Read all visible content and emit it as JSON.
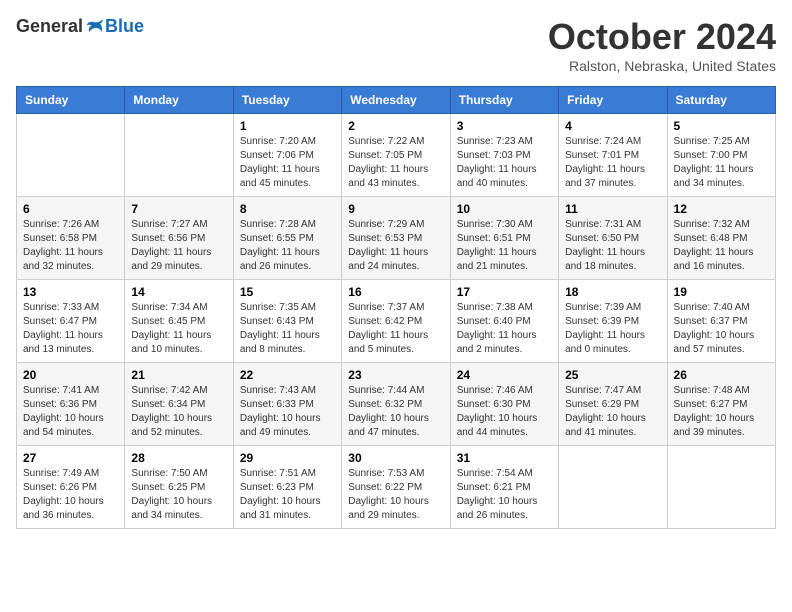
{
  "header": {
    "logo_general": "General",
    "logo_blue": "Blue",
    "title": "October 2024",
    "location": "Ralston, Nebraska, United States"
  },
  "calendar": {
    "days_of_week": [
      "Sunday",
      "Monday",
      "Tuesday",
      "Wednesday",
      "Thursday",
      "Friday",
      "Saturday"
    ],
    "weeks": [
      [
        {
          "day": "",
          "sunrise": "",
          "sunset": "",
          "daylight": ""
        },
        {
          "day": "",
          "sunrise": "",
          "sunset": "",
          "daylight": ""
        },
        {
          "day": "1",
          "sunrise": "Sunrise: 7:20 AM",
          "sunset": "Sunset: 7:06 PM",
          "daylight": "Daylight: 11 hours and 45 minutes."
        },
        {
          "day": "2",
          "sunrise": "Sunrise: 7:22 AM",
          "sunset": "Sunset: 7:05 PM",
          "daylight": "Daylight: 11 hours and 43 minutes."
        },
        {
          "day": "3",
          "sunrise": "Sunrise: 7:23 AM",
          "sunset": "Sunset: 7:03 PM",
          "daylight": "Daylight: 11 hours and 40 minutes."
        },
        {
          "day": "4",
          "sunrise": "Sunrise: 7:24 AM",
          "sunset": "Sunset: 7:01 PM",
          "daylight": "Daylight: 11 hours and 37 minutes."
        },
        {
          "day": "5",
          "sunrise": "Sunrise: 7:25 AM",
          "sunset": "Sunset: 7:00 PM",
          "daylight": "Daylight: 11 hours and 34 minutes."
        }
      ],
      [
        {
          "day": "6",
          "sunrise": "Sunrise: 7:26 AM",
          "sunset": "Sunset: 6:58 PM",
          "daylight": "Daylight: 11 hours and 32 minutes."
        },
        {
          "day": "7",
          "sunrise": "Sunrise: 7:27 AM",
          "sunset": "Sunset: 6:56 PM",
          "daylight": "Daylight: 11 hours and 29 minutes."
        },
        {
          "day": "8",
          "sunrise": "Sunrise: 7:28 AM",
          "sunset": "Sunset: 6:55 PM",
          "daylight": "Daylight: 11 hours and 26 minutes."
        },
        {
          "day": "9",
          "sunrise": "Sunrise: 7:29 AM",
          "sunset": "Sunset: 6:53 PM",
          "daylight": "Daylight: 11 hours and 24 minutes."
        },
        {
          "day": "10",
          "sunrise": "Sunrise: 7:30 AM",
          "sunset": "Sunset: 6:51 PM",
          "daylight": "Daylight: 11 hours and 21 minutes."
        },
        {
          "day": "11",
          "sunrise": "Sunrise: 7:31 AM",
          "sunset": "Sunset: 6:50 PM",
          "daylight": "Daylight: 11 hours and 18 minutes."
        },
        {
          "day": "12",
          "sunrise": "Sunrise: 7:32 AM",
          "sunset": "Sunset: 6:48 PM",
          "daylight": "Daylight: 11 hours and 16 minutes."
        }
      ],
      [
        {
          "day": "13",
          "sunrise": "Sunrise: 7:33 AM",
          "sunset": "Sunset: 6:47 PM",
          "daylight": "Daylight: 11 hours and 13 minutes."
        },
        {
          "day": "14",
          "sunrise": "Sunrise: 7:34 AM",
          "sunset": "Sunset: 6:45 PM",
          "daylight": "Daylight: 11 hours and 10 minutes."
        },
        {
          "day": "15",
          "sunrise": "Sunrise: 7:35 AM",
          "sunset": "Sunset: 6:43 PM",
          "daylight": "Daylight: 11 hours and 8 minutes."
        },
        {
          "day": "16",
          "sunrise": "Sunrise: 7:37 AM",
          "sunset": "Sunset: 6:42 PM",
          "daylight": "Daylight: 11 hours and 5 minutes."
        },
        {
          "day": "17",
          "sunrise": "Sunrise: 7:38 AM",
          "sunset": "Sunset: 6:40 PM",
          "daylight": "Daylight: 11 hours and 2 minutes."
        },
        {
          "day": "18",
          "sunrise": "Sunrise: 7:39 AM",
          "sunset": "Sunset: 6:39 PM",
          "daylight": "Daylight: 11 hours and 0 minutes."
        },
        {
          "day": "19",
          "sunrise": "Sunrise: 7:40 AM",
          "sunset": "Sunset: 6:37 PM",
          "daylight": "Daylight: 10 hours and 57 minutes."
        }
      ],
      [
        {
          "day": "20",
          "sunrise": "Sunrise: 7:41 AM",
          "sunset": "Sunset: 6:36 PM",
          "daylight": "Daylight: 10 hours and 54 minutes."
        },
        {
          "day": "21",
          "sunrise": "Sunrise: 7:42 AM",
          "sunset": "Sunset: 6:34 PM",
          "daylight": "Daylight: 10 hours and 52 minutes."
        },
        {
          "day": "22",
          "sunrise": "Sunrise: 7:43 AM",
          "sunset": "Sunset: 6:33 PM",
          "daylight": "Daylight: 10 hours and 49 minutes."
        },
        {
          "day": "23",
          "sunrise": "Sunrise: 7:44 AM",
          "sunset": "Sunset: 6:32 PM",
          "daylight": "Daylight: 10 hours and 47 minutes."
        },
        {
          "day": "24",
          "sunrise": "Sunrise: 7:46 AM",
          "sunset": "Sunset: 6:30 PM",
          "daylight": "Daylight: 10 hours and 44 minutes."
        },
        {
          "day": "25",
          "sunrise": "Sunrise: 7:47 AM",
          "sunset": "Sunset: 6:29 PM",
          "daylight": "Daylight: 10 hours and 41 minutes."
        },
        {
          "day": "26",
          "sunrise": "Sunrise: 7:48 AM",
          "sunset": "Sunset: 6:27 PM",
          "daylight": "Daylight: 10 hours and 39 minutes."
        }
      ],
      [
        {
          "day": "27",
          "sunrise": "Sunrise: 7:49 AM",
          "sunset": "Sunset: 6:26 PM",
          "daylight": "Daylight: 10 hours and 36 minutes."
        },
        {
          "day": "28",
          "sunrise": "Sunrise: 7:50 AM",
          "sunset": "Sunset: 6:25 PM",
          "daylight": "Daylight: 10 hours and 34 minutes."
        },
        {
          "day": "29",
          "sunrise": "Sunrise: 7:51 AM",
          "sunset": "Sunset: 6:23 PM",
          "daylight": "Daylight: 10 hours and 31 minutes."
        },
        {
          "day": "30",
          "sunrise": "Sunrise: 7:53 AM",
          "sunset": "Sunset: 6:22 PM",
          "daylight": "Daylight: 10 hours and 29 minutes."
        },
        {
          "day": "31",
          "sunrise": "Sunrise: 7:54 AM",
          "sunset": "Sunset: 6:21 PM",
          "daylight": "Daylight: 10 hours and 26 minutes."
        },
        {
          "day": "",
          "sunrise": "",
          "sunset": "",
          "daylight": ""
        },
        {
          "day": "",
          "sunrise": "",
          "sunset": "",
          "daylight": ""
        }
      ]
    ]
  }
}
